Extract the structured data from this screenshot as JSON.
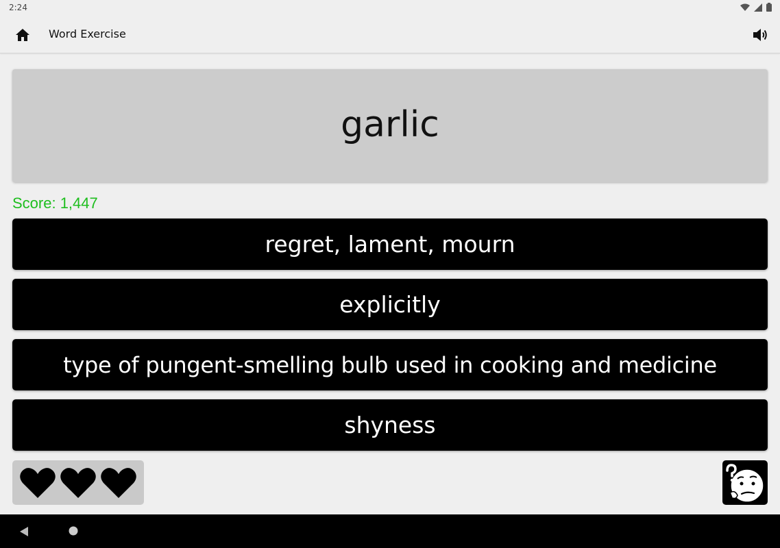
{
  "status_bar": {
    "time": "2:24",
    "icons": [
      "wifi-icon",
      "signal-icon",
      "battery-icon"
    ]
  },
  "app_bar": {
    "title": "Word Exercise",
    "icons": [
      "home-icon",
      "volume-icon"
    ]
  },
  "exercise": {
    "word": "garlic",
    "score_label": "Score: 1,447",
    "answers": [
      {
        "label": "regret, lament, mourn"
      },
      {
        "label": "explicitly"
      },
      {
        "label": "type of pungent-smelling bulb used in cooking and medicine"
      },
      {
        "label": "shyness"
      }
    ]
  },
  "lives": {
    "remaining": 3,
    "icon": "heart-icon"
  },
  "help": {
    "icon": "confused-face-hint-icon"
  },
  "nav_bar": {
    "icons": [
      "back-icon",
      "home-circle-icon"
    ]
  },
  "colors": {
    "background": "#efefef",
    "card": "#cccccc",
    "answer_bg": "#000000",
    "answer_text": "#ffffff",
    "score": "#1ebe1e"
  }
}
